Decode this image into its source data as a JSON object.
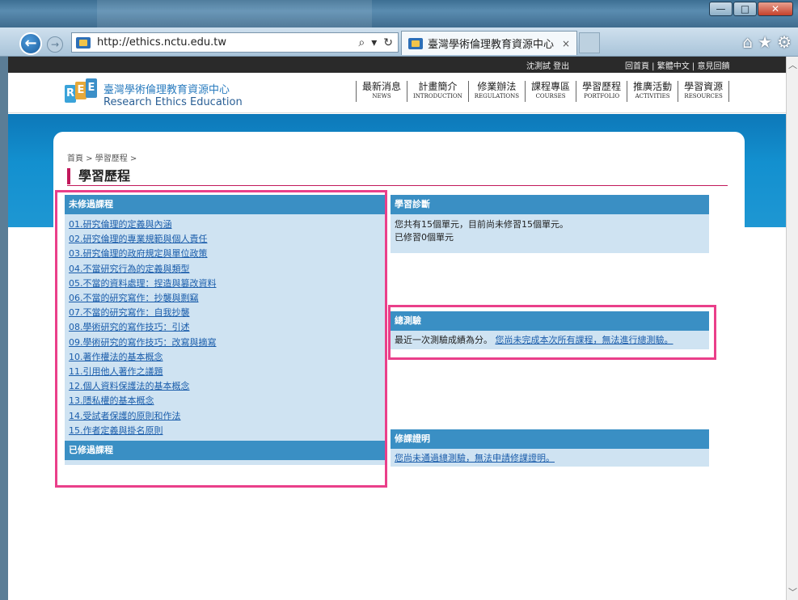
{
  "browser": {
    "url": "http://ethics.nctu.edu.tw",
    "tab_title": "臺灣學術倫理教育資源中心",
    "tab_close": "×"
  },
  "site": {
    "top_user": "沈測試  登出",
    "top_links": "回首頁 | 繁體中文 | 意見回饋",
    "logo_cn": "臺灣學術倫理教育資源中心",
    "logo_en": "Research Ethics Education",
    "menu": [
      {
        "cn": "最新消息",
        "en": "NEWS"
      },
      {
        "cn": "計畫簡介",
        "en": "INTRODUCTION"
      },
      {
        "cn": "修業辦法",
        "en": "REGULATIONS"
      },
      {
        "cn": "課程專區",
        "en": "COURSES"
      },
      {
        "cn": "學習歷程",
        "en": "PORTFOLIO"
      },
      {
        "cn": "推廣活動",
        "en": "ACTIVITIES"
      },
      {
        "cn": "學習資源",
        "en": "RESOURCES"
      }
    ]
  },
  "page": {
    "breadcrumb": "首頁 > 學習歷程 >",
    "title": "學習歷程"
  },
  "left": {
    "incomplete_header": "未修過課程",
    "courses": [
      "01.研究倫理的定義與內涵",
      "02.研究倫理的專業規範與個人責任",
      "03.研究倫理的政府規定與單位政策",
      "04.不當研究行為的定義與類型",
      "05.不當的資料處理：捏造與篡改資料",
      "06.不當的研究寫作：抄襲與剽竊",
      "07.不當的研究寫作：自我抄襲",
      "08.學術研究的寫作技巧：引述",
      "09.學術研究的寫作技巧：改寫與摘寫",
      "10.著作權法的基本概念",
      "11.引用他人著作之議題",
      "12.個人資料保護法的基本概念",
      "13.隱私權的基本概念",
      "14.受試者保護的原則和作法",
      "15.作者定義與掛名原則"
    ],
    "completed_header": "已修過課程"
  },
  "diagnosis": {
    "header": "學習診斷",
    "line1": "您共有15個單元，目前尚未修習15個單元。",
    "line2": "已修習0個單元"
  },
  "exam": {
    "header": "總測驗",
    "text": "最近一次測驗成績為分。",
    "link": "您尚未完成本次所有課程，無法進行總測驗。"
  },
  "certificate": {
    "header": "修課證明",
    "link": "您尚未通過總測驗，無法申請修課證明。"
  }
}
